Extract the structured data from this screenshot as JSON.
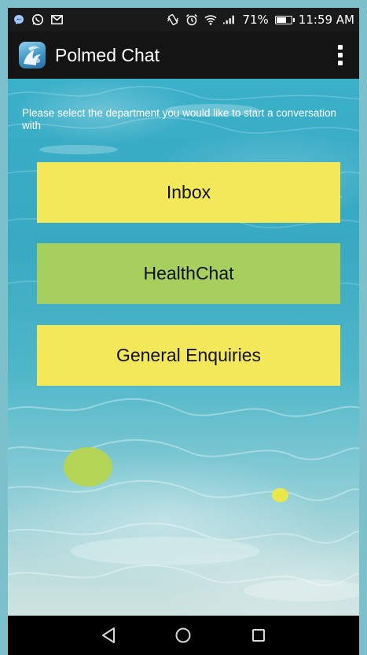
{
  "status_bar": {
    "left_icons": [
      "bluetooth-messenger-icon",
      "whatsapp-icon",
      "gmail-icon"
    ],
    "right_icons": [
      "vibrate-icon",
      "alarm-icon",
      "wifi-icon",
      "signal-icon"
    ],
    "battery_percent": "71%",
    "battery_level": 0.71,
    "time": "11:59 AM"
  },
  "action_bar": {
    "title": "Polmed Chat",
    "menu_icon": "overflow-menu-icon"
  },
  "main": {
    "instruction": "Please select the department you would like to start a conversation with",
    "departments": [
      {
        "label": "Inbox",
        "color": "#f2e85a"
      },
      {
        "label": "HealthChat",
        "color": "#a6cf5e"
      },
      {
        "label": "General Enquiries",
        "color": "#f2e85a"
      }
    ]
  },
  "nav_bar": {
    "buttons": [
      "back-icon",
      "home-icon",
      "recents-icon"
    ]
  },
  "colors": {
    "status_bar_bg": "#1a1a1a",
    "action_bar_bg": "#141414",
    "yellow_button": "#f2e85a",
    "green_button": "#a6cf5e",
    "water": "#38a9c2"
  }
}
